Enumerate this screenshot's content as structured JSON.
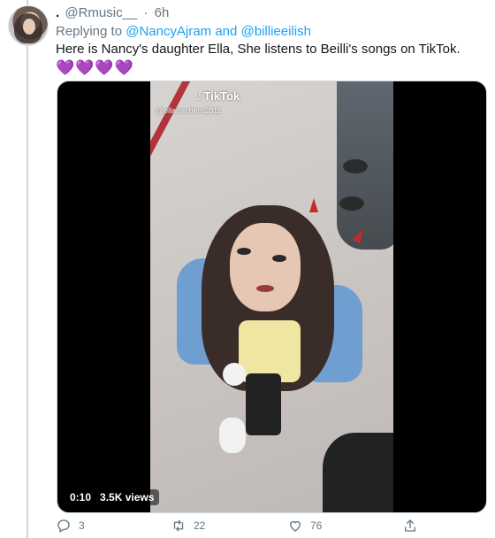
{
  "tweet": {
    "display_name": ".",
    "handle": "@Rmusic__",
    "separator": "·",
    "time": "6h",
    "reply_prefix": "Replying to",
    "reply_to_1": "@NancyAjram",
    "reply_and": "and",
    "reply_to_2": "@billieeilish",
    "text": "Here is Nancy's daughter Ella, She listens to Beilli's songs on TikTok.",
    "emoji_hearts": "💜💜💜💜"
  },
  "media": {
    "watermark_brand": "TikTok",
    "watermark_handle": "@ellanachem2011",
    "duration": "0:10",
    "views": "3.5K views"
  },
  "actions": {
    "reply_count": "3",
    "retweet_count": "22",
    "like_count": "76"
  },
  "colors": {
    "link": "#1da1f2",
    "secondary_text": "#657786",
    "heart_emoji": "#a68dd9"
  }
}
